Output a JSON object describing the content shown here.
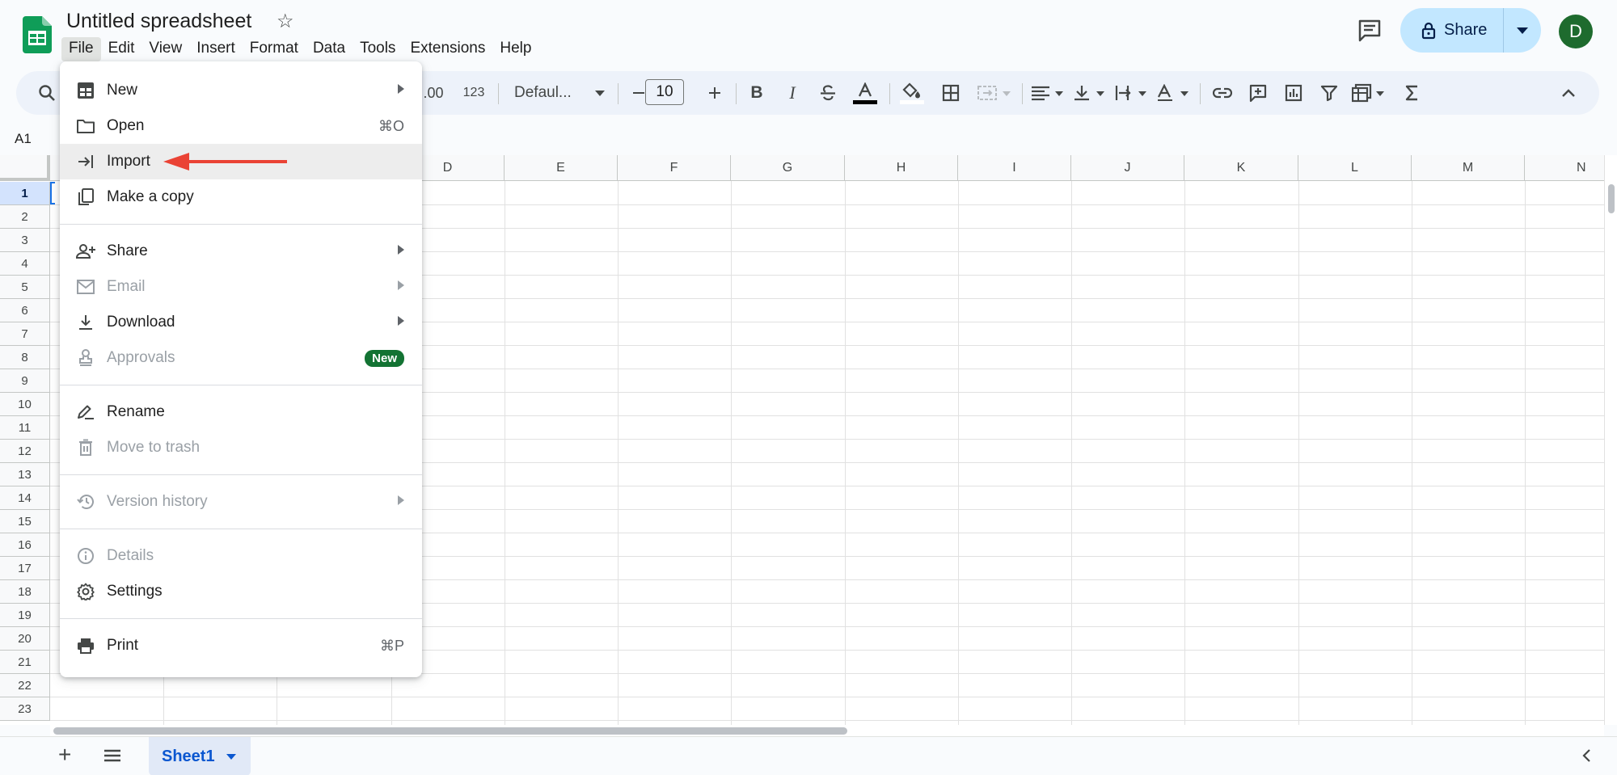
{
  "doc": {
    "title": "Untitled spreadsheet"
  },
  "menubar": [
    "File",
    "Edit",
    "View",
    "Insert",
    "Format",
    "Data",
    "Tools",
    "Extensions",
    "Help"
  ],
  "share": {
    "label": "Share"
  },
  "account": {
    "initial": "D"
  },
  "toolbar": {
    "decimal_label": ".00",
    "number_format": "123",
    "font": "Defaul...",
    "font_size": "10",
    "bold": "B",
    "italic": "I"
  },
  "namebox": "A1",
  "columns": [
    "D",
    "E",
    "F",
    "G",
    "H",
    "I",
    "J",
    "K",
    "L",
    "M",
    "N"
  ],
  "rows": [
    "1",
    "2",
    "3",
    "4",
    "5",
    "6",
    "7",
    "8",
    "9",
    "10",
    "11",
    "12",
    "13",
    "14",
    "15",
    "16",
    "17",
    "18",
    "19",
    "20",
    "21",
    "22",
    "23"
  ],
  "sheet": {
    "tab": "Sheet1"
  },
  "file_menu": {
    "new": "New",
    "open": "Open",
    "open_shortcut": "⌘O",
    "import": "Import",
    "make_copy": "Make a copy",
    "share": "Share",
    "email": "Email",
    "download": "Download",
    "approvals": "Approvals",
    "approvals_badge": "New",
    "rename": "Rename",
    "trash": "Move to trash",
    "version_history": "Version history",
    "details": "Details",
    "settings": "Settings",
    "print": "Print",
    "print_shortcut": "⌘P"
  },
  "colors": {
    "accent": "#0b57d0",
    "share_bg": "#c2e7ff",
    "badge": "#137333",
    "annotation": "#ea4335",
    "avatar": "#1e6b2e"
  }
}
